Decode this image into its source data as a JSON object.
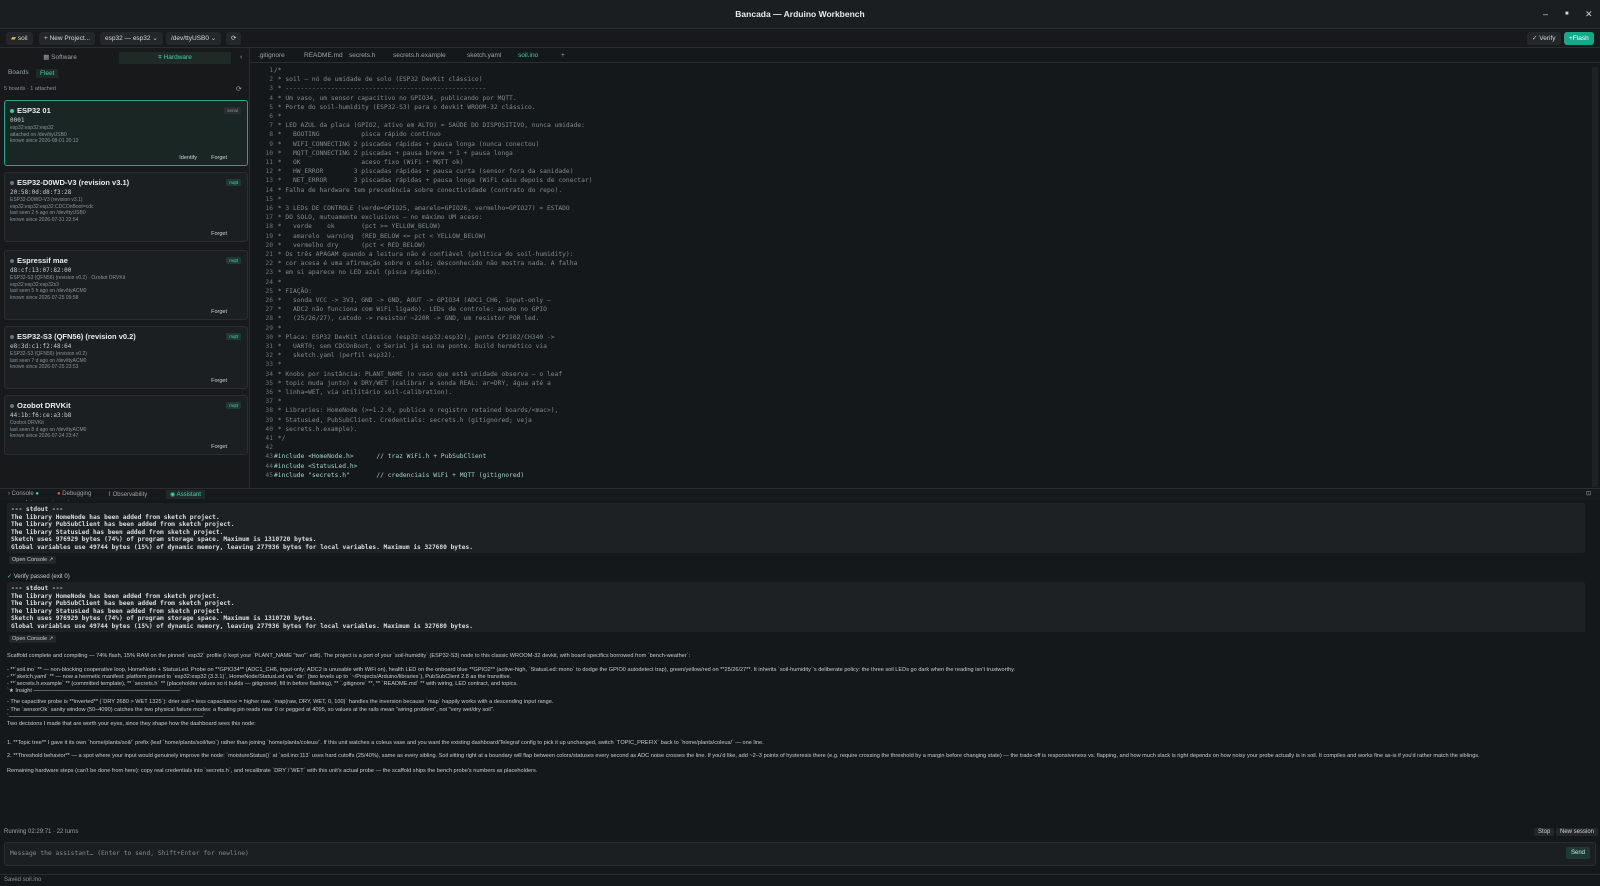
{
  "window": {
    "title": "Bancada — Arduino Workbench",
    "minimize": "–",
    "maximize": "■",
    "close": "✕"
  },
  "toolbar": {
    "project": "soil",
    "new_project": "+ New Project...",
    "board": "esp32 — esp32",
    "port": "/dev/ttyUSB0",
    "verify": "Verify",
    "flash": "Flash"
  },
  "sidebar": {
    "tabs": [
      "Software",
      "Hardware"
    ],
    "active_tab": "Hardware",
    "subtabs": [
      "Boards",
      "Fleet"
    ],
    "active_subtab": "Fleet",
    "count": "5 boards · 1 attached",
    "boards": [
      {
        "name": "ESP32 01",
        "id": "0001",
        "badge": "serial",
        "meta": [
          "esp32:esp32:esp32",
          "attached on /dev/ttyUSB0",
          "known since 2026-08-01 20:13"
        ],
        "actions": [
          "Identify",
          "Forget"
        ],
        "selected": true
      },
      {
        "name": "ESP32-D0WD-V3 (revision v3.1)",
        "id": "20:58:0d:d8:f3:28",
        "badge": "mqtt",
        "meta": [
          "ESP32-D0WD-V3 (revision v3.1)",
          "esp32:esp32:esp32:CDCOnBoot=cdc",
          "last seen 2 h ago on /dev/ttyUSB0",
          "known since 2026-07-31 22:54"
        ],
        "actions": [
          "Forget"
        ],
        "selected": false
      },
      {
        "name": "Espressif mae",
        "id": "d8:cf:13:07:82:00",
        "badge": "mqtt",
        "meta": [
          "ESP32-S3 (QFN56) (revision v0.2) · Ozobot DRVKit",
          "esp32:esp32:esp32s3",
          "last seen 5 h ago on /dev/ttyACM0",
          "known since 2026-07-25 09:58"
        ],
        "actions": [
          "Forget"
        ],
        "selected": false
      },
      {
        "name": "ESP32-S3 (QFN56) (revision v0.2)",
        "id": "e8:3d:c1:f2:48:64",
        "badge": "mqtt",
        "meta": [
          "ESP32-S3 (QFN56) (revision v0.2)",
          "last seen 7 d ago on /dev/ttyACM0",
          "known since 2026-07-25 23:53"
        ],
        "actions": [
          "Forget"
        ],
        "selected": false
      },
      {
        "name": "Ozobot DRVKit",
        "id": "44:1b:f6:ce:a3:b8",
        "badge": "mqtt",
        "meta": [
          "Ozobot DRVKit",
          "last seen 8 d ago on /dev/ttyACM0",
          "known since 2026-07-24 23:47"
        ],
        "actions": [
          "Forget"
        ],
        "selected": false
      }
    ]
  },
  "editor": {
    "tabs": [
      ".gitignore",
      "README.md",
      "secrets.h",
      "secrets.h.example",
      "sketch.yaml",
      "soil.ino",
      "+"
    ],
    "active_tab": "soil.ino",
    "lines": [
      "/*",
      " * soil — nó de umidade de solo (ESP32 DevKit clássico)",
      " * -----------------------------------------------------",
      " * Um vaso, um sensor capacitivo no GPIO34, publicando por MQTT.",
      " * Porte do soil-humidity (ESP32-S3) para o devkit WROOM-32 clássico.",
      " *",
      " * LED AZUL da placa (GPIO2, ativo em ALTO) = SAÚDE DO DISPOSITIVO, nunca umidade:",
      " *   BOOTING           pisca rápido contínuo",
      " *   WIFI_CONNECTING 2 piscadas rápidas + pausa longa (nunca conectou)",
      " *   MQTT_CONNECTING 2 piscadas + pausa breve + 1 + pausa longa",
      " *   OK                aceso fixo (WiFi + MQTT ok)",
      " *   HW_ERROR        3 piscadas rápidas + pausa curta (sensor fora da sanidade)",
      " *   NET_ERROR       3 piscadas rápidas + pausa longa (WiFi caiu depois de conectar)",
      " * Falha de hardware tem precedência sobre conectividade (contrato do repo).",
      " *",
      " * 3 LEDs DE CONTROLE (verde=GPIO25, amarelo=GPIO26, vermelho=GPIO27) = ESTADO",
      " * DO SOLO, mutuamente exclusivos — no máximo UM aceso:",
      " *   verde    ok       (pct >= YELLOW_BELOW)",
      " *   amarelo  warning  (RED_BELOW <= pct < YELLOW_BELOW)",
      " *   vermelho dry      (pct < RED_BELOW)",
      " * Os três APAGAM quando a leitura não é confiável (política do soil-humidity):",
      " * cor acesa é uma afirmação sobre o solo; desconhecido não mostra nada. A falha",
      " * em si aparece no LED azul (pisca rápido).",
      " *",
      " * FIAÇÃO:",
      " *   sonda VCC -> 3V3, GND -> GND, AOUT -> GPIO34 (ADC1_CH6, input-only —",
      " *   ADC2 não funciona com WiFi ligado). LEDs de controle: anodo no GPIO",
      " *   (25/26/27), catodo -> resistor ~220R -> GND, um resistor POR led.",
      " *",
      " * Placa: ESP32 DevKit clássico (esp32:esp32:esp32), ponte CP2102/CH340 ->",
      " *   UART0; sem CDCOnBoot, o Serial já sai na ponte. Build hermético via",
      " *   sketch.yaml (perfil esp32).",
      " *",
      " * Knobs por instância: PLANT_NAME (o vaso que está unidade observa — o leaf",
      " * topic muda junto) e DRY/WET (calibrar a sonda REAL: ar=DRY, água até a",
      " * linha=WET, via utilitário soil-calibration).",
      " *",
      " * Libraries: HomeNode (>=1.2.0, publica o registro retained boards/<mac>),",
      " * StatusLed, PubSubClient. Credentials: secrets.h (gitignored; veja",
      " * secrets.h.example).",
      " */",
      "",
      "#include <HomeNode.h>      // traz WiFi.h + PubSubClient",
      "#include <StatusLed.h>",
      "#include \"secrets.h\"       // credenciais WiFi + MQTT (gitignored)"
    ]
  },
  "bottom_tabs": [
    "Console",
    "Debugging",
    "Observability",
    "Assistant"
  ],
  "active_bottom_tab": "Assistant",
  "assistant": {
    "verify_label": "Verify passed (exit 0)",
    "open_console": "Open Console ↗",
    "stdout": [
      "--- stdout ---",
      "The library HomeNode has been added from sketch project.",
      "The library PubSubClient has been added from sketch project.",
      "The library StatusLed has been added from sketch project.",
      "Sketch uses 976929 bytes (74%) of program storage space. Maximum is 1310720 bytes.",
      "Global variables use 49744 bytes (15%) of dynamic memory, leaving 277936 bytes for local variables. Maximum is 327680 bytes."
    ],
    "message": [
      "Scaffold complete and compiling — 74% flash, 15% RAM on the pinned `esp32` profile (I kept your `PLANT_NAME \"two\"` edit). The project is a port of your `soil-humidity` (ESP32-S3) node to this classic WROOM-32 devkit, with board specifics borrowed from `bench-weather`:",
      "- **`soil.ino` ** — non-blocking cooperative loop, HomeNode + StatusLed. Probe on **GPIO34** (ADC1_CH6, input-only; ADC2 is unusable with WiFi on), health LED on the onboard blue **GPIO2** (active-high, `StatusLed::mono` to dodge the GPIO0 autodetect trap), green/yellow/red on **25/26/27**. It inherits `soil-humidity`'s deliberate policy: the three soil LEDs go dark when the reading isn't trustworthy.",
      "- **`sketch.yaml` ** — now a hermetic manifest: platform pinned to `esp32:esp32 (3.3.1)`, HomeNode/StatusLed via `dir:` (two levels up to `~/Projects/Arduino/libraries`), PubSubClient 2.8 as the transitive.",
      "- **`secrets.h.example` ** (committed template), ** `secrets.h` ** (placeholder values so it builds — gitignored, fill in before flashing), ** `.gitignore` **, ** `README.md` ** with wiring, LED contract, and topics.",
      "`★ Insight ─────────────────────────────────────`",
      "- The capacitive probe is **inverted** (`DRY 2680 > WET 1325`): drier soil = less capacitance = higher raw. `map(raw, DRY, WET, 0, 100)` handles the inversion because `map` happily works with a descending input range.",
      "- The `sensorOk` sanity window (50–4090) catches the two physical failure modes: a floating pin reads near 0 or pegged at 4095, so values at the rails mean \"wiring problem\", not \"very wet/dry soil\".",
      "`─────────────────────────────────────────────────`",
      "Two decisions I made that are worth your eyes, since they shape how the dashboard sees this node:",
      "1. **Topic tree** I gave it its own `home/plants/soil/` prefix (leaf `home/plants/soil/two`) rather than joining `home/plants/coleus/`. If this unit watches a coleus vase and you want the existing dashboard/Telegraf config to pick it up unchanged, switch `TOPIC_PREFIX` back to `home/plants/coleus/` — one line.",
      "2. **Threshold behavior** — a spot where your input would genuinely improve the node: `moistureStatus()` at `soil.ino:113` uses hard cutoffs (25/40%), same as every sibling. Soil sitting right at a boundary will flap between colors/statuses every second as ADC noise crosses the line. If you'd like, add ~2–3 points of hysteresis there (e.g. require crossing the threshold by a margin before changing state) — the trade-off is responsiveness vs. flapping, and how much slack is right depends on how noisy your probe actually is in soil. It compiles and works fine as-is if you'd rather match the siblings.",
      "Remaining hardware steps (can't be done from here): copy real credentials into `secrets.h`, and recalibrate `DRY`/`WET` with this unit's actual probe — the scaffold ships the bench probe's numbers as placeholders."
    ]
  },
  "status": {
    "running": "Running  02:29:71 · 22 turns",
    "stop": "Stop",
    "new_session": "New session"
  },
  "input": {
    "placeholder": "Message the assistant… (Enter to send, Shift+Enter for newline)",
    "send": "Send"
  },
  "footer": {
    "text": "Saved soil.ino"
  }
}
